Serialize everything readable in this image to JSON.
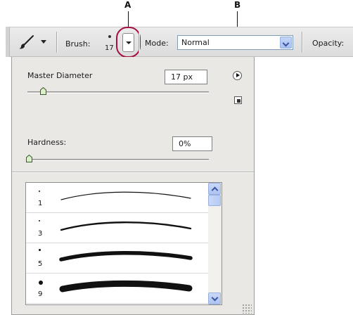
{
  "callouts": {
    "a": "A",
    "b": "B"
  },
  "options_bar": {
    "tool_icon": "brush-tool-icon",
    "brush_label": "Brush:",
    "brush_size": "17",
    "mode_label": "Mode:",
    "mode_value": "Normal",
    "opacity_label": "Opacity:"
  },
  "panel": {
    "master_diameter_label": "Master Diameter",
    "master_diameter_value": "17 px",
    "master_diameter_slider_fraction": 0.13,
    "hardness_label": "Hardness:",
    "hardness_value": "0%",
    "hardness_slider_fraction": 0.0,
    "menu_icon": "flyout-menu-icon",
    "new_preset_icon": "new-preset-icon"
  },
  "brushes": [
    {
      "size": "1"
    },
    {
      "size": "3"
    },
    {
      "size": "5"
    },
    {
      "size": "9"
    }
  ],
  "colors": {
    "highlight_ring": "#a4103f",
    "scroll_blue": "#aec4f0"
  }
}
